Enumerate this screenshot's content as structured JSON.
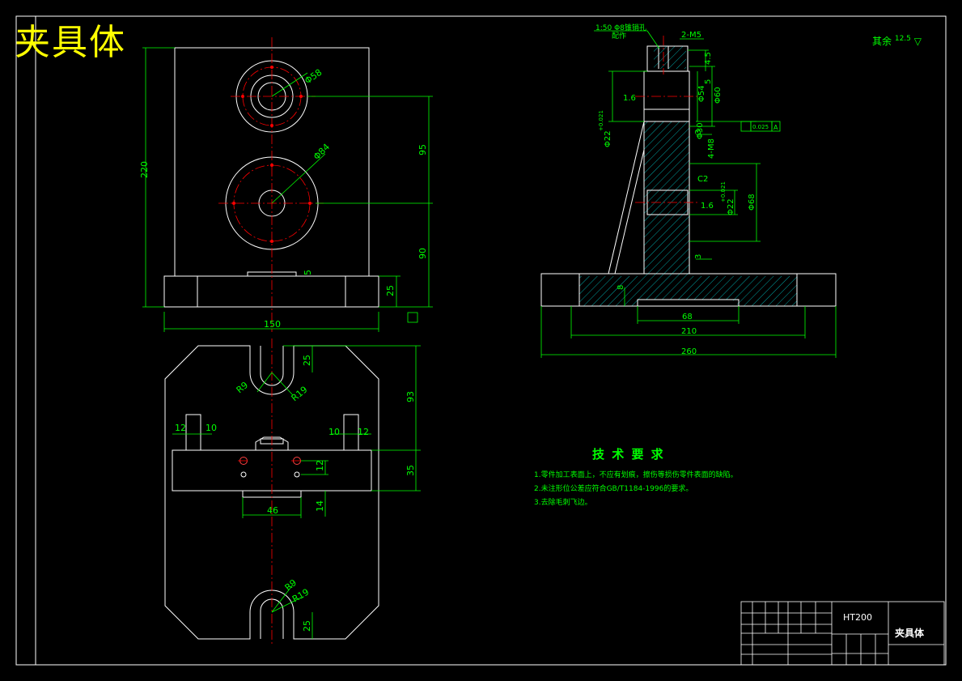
{
  "drawing_title": "夹具体",
  "tech_requirements": {
    "heading": "技 术 要 求",
    "items": [
      "1.零件加工表面上，不应有划痕，擦伤等损伤零件表面的缺陷。",
      "2.未注形位公差应符合GB/T1184-1996的要求。",
      "3.去除毛刺飞边。"
    ]
  },
  "surface_roughness": {
    "label": "其余",
    "value": "12.5"
  },
  "title_block": {
    "material": "HT200",
    "part_name": "夹具体"
  },
  "dimensions": {
    "front": {
      "height_220": "220",
      "d58": "Φ58",
      "d84": "Φ84",
      "v95": "95",
      "v90": "90",
      "v25": "25",
      "v5": "5",
      "w150": "150"
    },
    "top": {
      "v25a": "25",
      "r9a": "R9",
      "r19a": "R19",
      "v93": "93",
      "d12l": "12",
      "d10l": "10",
      "d10r": "10",
      "d12r": "12",
      "v12": "12",
      "v14": "14",
      "v35": "35",
      "w46": "46",
      "r9b": "R9",
      "r19b": "R19",
      "v25b": "25"
    },
    "side": {
      "taper": "1:50 Φ8锥销孔",
      "taper2": "配作",
      "m5": "2-M5",
      "v4_5": "4.5",
      "v5": "5",
      "d54": "Φ54",
      "d60": "Φ60",
      "d22a": "Φ22",
      "tol_a": "+0.021",
      "rough_a": "1.6",
      "d30": "Φ30",
      "m8": "4-M8",
      "c2": "C2",
      "d22b": "Φ22",
      "tol_b": "+0.021",
      "rough_b": "1.6",
      "d68": "Φ68",
      "v3a": "3",
      "v3b": "3",
      "v8": "8",
      "w68": "68",
      "w210": "210",
      "w260": "260",
      "gtol_val": "0.025",
      "gtol_ref": "A"
    }
  },
  "colors": {
    "outline": "#ffffff",
    "dimension": "#00ff00",
    "center": "#ff0000",
    "title": "#ffff00",
    "hatch": "#00ffff"
  }
}
